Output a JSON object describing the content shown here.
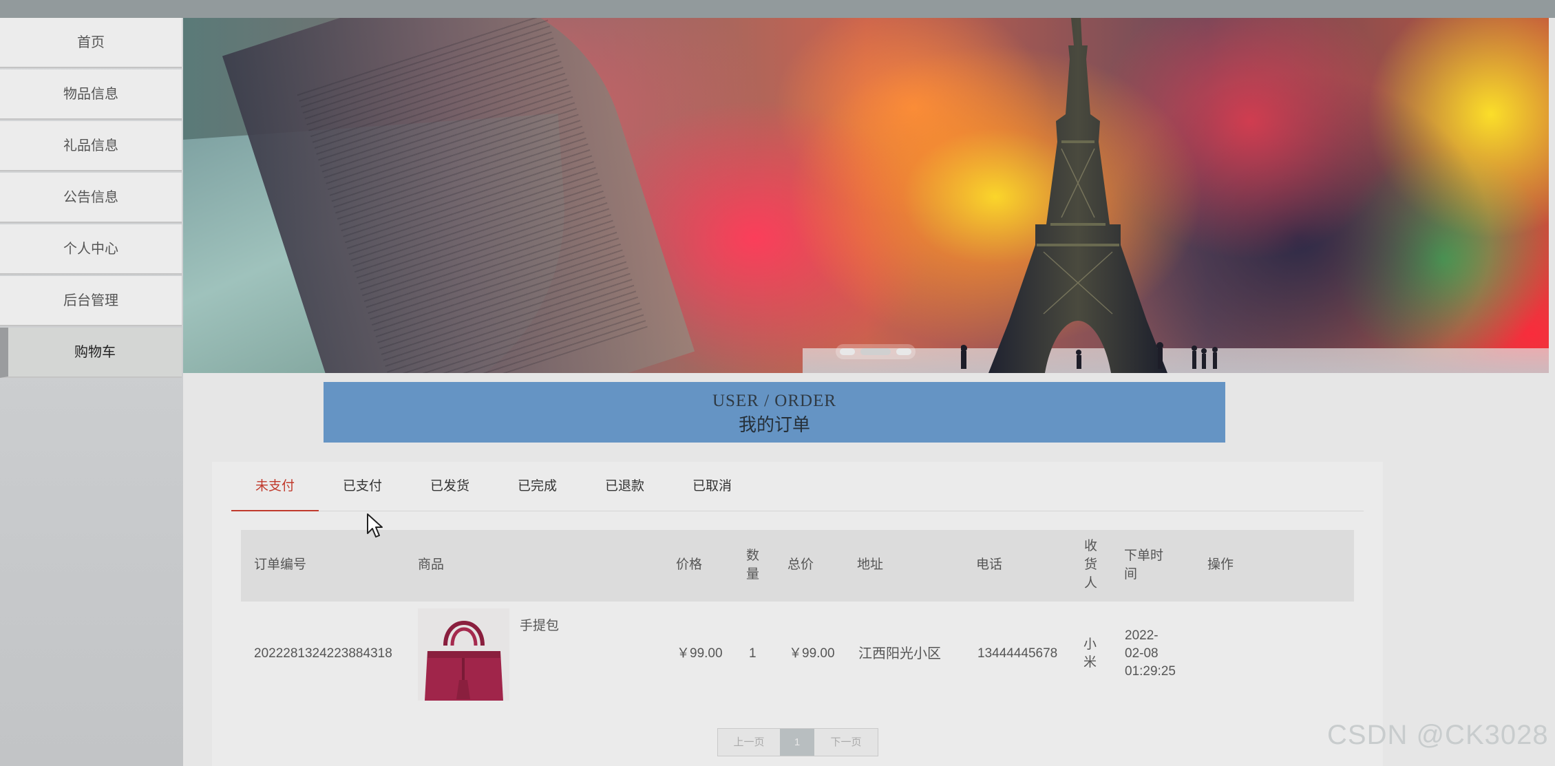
{
  "sidebar": {
    "items": [
      {
        "label": "首页"
      },
      {
        "label": "物品信息"
      },
      {
        "label": "礼品信息"
      },
      {
        "label": "公告信息"
      },
      {
        "label": "个人中心"
      },
      {
        "label": "后台管理"
      },
      {
        "label": "购物车",
        "active": true
      }
    ]
  },
  "banner": {
    "dots": 3,
    "active_dot": 2
  },
  "header": {
    "title_en": "USER / ORDER",
    "title_cn": "我的订单",
    "band_color": "#6594c4"
  },
  "tabs": [
    {
      "label": "未支付",
      "active": true
    },
    {
      "label": "已支付"
    },
    {
      "label": "已发货"
    },
    {
      "label": "已完成"
    },
    {
      "label": "已退款"
    },
    {
      "label": "已取消"
    }
  ],
  "table": {
    "columns": [
      "订单编号",
      "商品",
      "价格",
      "数量",
      "总价",
      "地址",
      "电话",
      "收货人",
      "下单时间",
      "操作"
    ],
    "rows": [
      {
        "order_no": "2022281324223884318",
        "product_name": "手提包",
        "product_image_icon": "handbag-image",
        "price": "￥99.00",
        "quantity": "1",
        "total": "￥99.00",
        "address": "江西阳光小区",
        "phone": "13444445678",
        "receiver": "小米",
        "order_time_date": "2022-",
        "order_time_date2": "02-08",
        "order_time_clock": "01:29:25",
        "action": ""
      }
    ]
  },
  "pagination": {
    "prev": "上一页",
    "current": "1",
    "next": "下一页"
  },
  "watermark": "CSDN @CK3028",
  "accent_color": "#c0392b"
}
